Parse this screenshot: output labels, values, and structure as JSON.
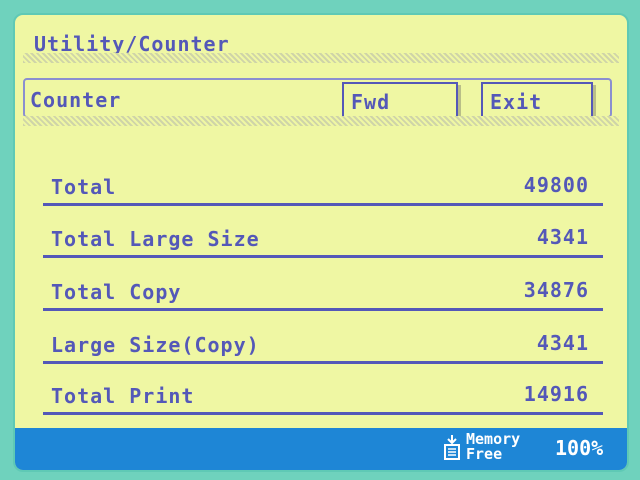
{
  "header": {
    "title": "Utility/Counter"
  },
  "panel": {
    "label": "Counter",
    "fwd_label": "Fwd",
    "exit_label": "Exit"
  },
  "counters": [
    {
      "label": "Total",
      "value": "49800"
    },
    {
      "label": "Total Large Size",
      "value": "4341"
    },
    {
      "label": "Total Copy",
      "value": "34876"
    },
    {
      "label": "Large Size(Copy)",
      "value": "4341"
    },
    {
      "label": "Total Print",
      "value": "14916"
    }
  ],
  "status": {
    "memory_line1": "Memory",
    "memory_line2": "Free",
    "memory_percent": "100%",
    "icon": "memory-icon"
  },
  "colors": {
    "screen_bg": "#eff7a3",
    "text": "#5458b8",
    "status_bar": "#1e86d6",
    "bezel": "#6fd2bd"
  }
}
